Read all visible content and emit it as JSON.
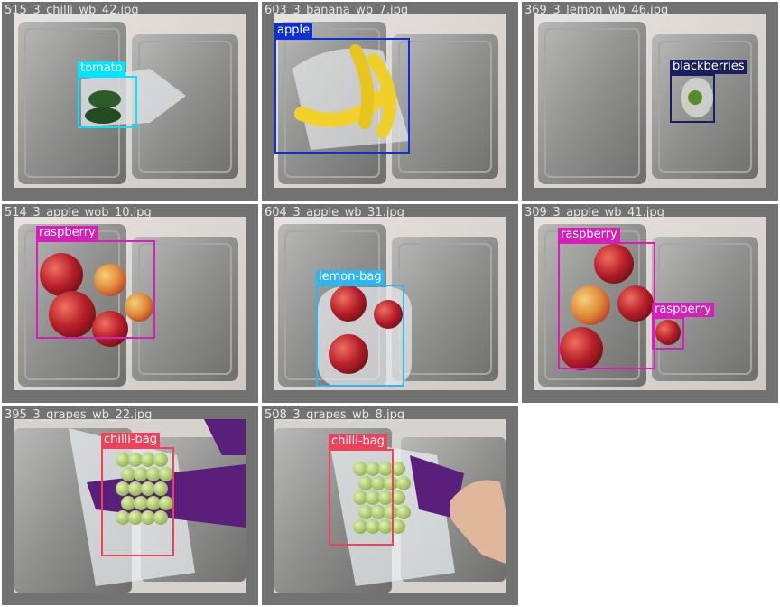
{
  "tiles": [
    {
      "filename": "515_3_chilli_wb_42.jpg",
      "scene": "tray",
      "objects": [
        {
          "label": "tomato",
          "color": "#00e5ff"
        }
      ]
    },
    {
      "filename": "603_3_banana_wb_7.jpg",
      "scene": "tray",
      "objects": [
        {
          "label": "apple",
          "color": "#0d2fd9"
        }
      ]
    },
    {
      "filename": "369_3_lemon_wb_46.jpg",
      "scene": "tray",
      "objects": [
        {
          "label": "blackberries",
          "color": "#1a1f5c"
        }
      ]
    },
    {
      "filename": "514_3_apple_wob_10.jpg",
      "scene": "tray",
      "objects": [
        {
          "label": "raspberry",
          "color": "#d61fb8"
        }
      ]
    },
    {
      "filename": "604_3_apple_wb_31.jpg",
      "scene": "tray",
      "objects": [
        {
          "label": "lemon-bag",
          "color": "#2fb6f0"
        }
      ]
    },
    {
      "filename": "309_3_apple_wb_41.jpg",
      "scene": "tray",
      "objects": [
        {
          "label": "raspberry",
          "color": "#d61fb8"
        },
        {
          "label": "raspberry",
          "color": "#d61fb8"
        }
      ]
    },
    {
      "filename": "395_3_grapes_wb_22.jpg",
      "scene": "bag",
      "objects": [
        {
          "label": "chilli-bag",
          "color": "#f0405a"
        }
      ]
    },
    {
      "filename": "508_3_grapes_wb_8.jpg",
      "scene": "bag-hand",
      "objects": [
        {
          "label": "chilli-bag",
          "color": "#f0405a"
        }
      ]
    }
  ]
}
